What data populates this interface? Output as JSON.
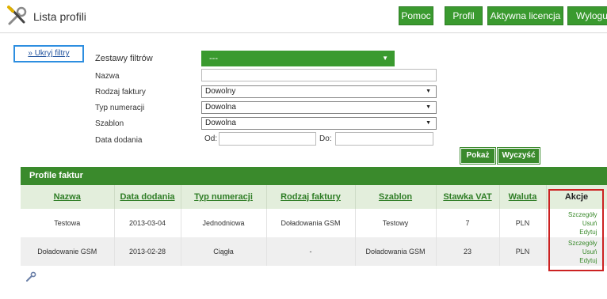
{
  "header": {
    "title": "Lista profili",
    "buttons": {
      "help": "Pomoc",
      "profil": "Profil",
      "license": "Aktywna licencja",
      "logout": "Wyloguj"
    }
  },
  "filters": {
    "toggle_label": "» Ukryj filtry",
    "filter_sets_label": "Zestawy filtrów",
    "filter_sets_value": "---",
    "name_label": "Nazwa",
    "name_value": "",
    "invoice_type_label": "Rodzaj faktury",
    "invoice_type_value": "Dowolny",
    "numbering_type_label": "Typ numeracji",
    "numbering_type_value": "Dowolna",
    "template_label": "Szablon",
    "template_value": "Dowolna",
    "date_added_label": "Data dodania",
    "from_label": "Od:",
    "to_label": "Do:",
    "from_value": "",
    "to_value": "",
    "show_button": "Pokaż",
    "clear_button": "Wyczyść"
  },
  "table": {
    "title": "Profile faktur",
    "columns": [
      "Nazwa",
      "Data dodania",
      "Typ numeracji",
      "Rodzaj faktury",
      "Szablon",
      "Stawka VAT",
      "Waluta",
      "Akcje"
    ],
    "rows": [
      [
        "Testowa",
        "2013-03-04",
        "Jednodniowa",
        "Doładowania GSM",
        "Testowy",
        "7",
        "PLN"
      ],
      [
        "Doładowanie GSM",
        "2013-02-28",
        "Ciągła",
        "-",
        "Doładowania GSM",
        "23",
        "PLN"
      ]
    ],
    "actions": {
      "details": "Szczegóły",
      "delete": "Usuń",
      "edit": "Edytuj"
    }
  },
  "colors": {
    "primary_green": "#3a9a2f",
    "highlight_red": "#cc2222",
    "focus_blue": "#2d8ee0"
  }
}
